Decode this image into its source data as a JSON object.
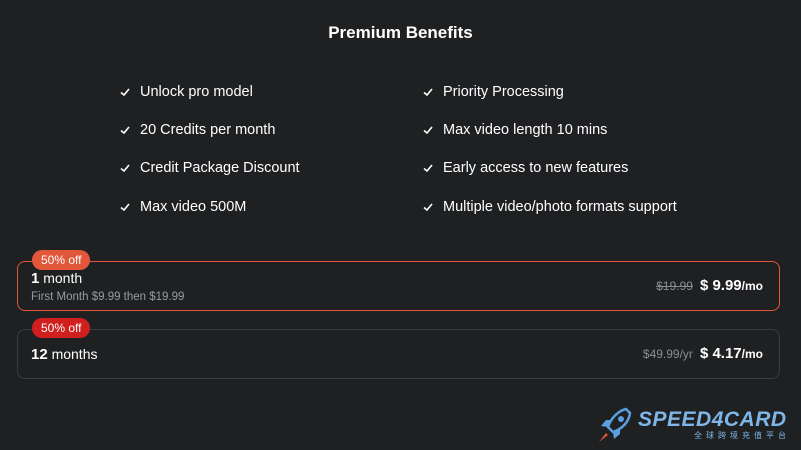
{
  "title": "Premium Benefits",
  "benefits": {
    "left": [
      "Unlock pro model",
      "20 Credits per month",
      "Credit Package Discount",
      "Max video 500M"
    ],
    "right": [
      "Priority Processing",
      "Max video length 10 mins",
      "Early access to new features",
      "Multiple video/photo formats support"
    ]
  },
  "plans": [
    {
      "badge": "50% off",
      "name_num": "1",
      "name_unit": " month",
      "subtitle": "First Month $9.99 then $19.99",
      "old_price": "$19.99",
      "new_price": "$ 9.99",
      "per": "/mo",
      "selected": true
    },
    {
      "badge": "50% off",
      "name_num": "12",
      "name_unit": " months",
      "old_price": "$49.99/yr",
      "new_price": "$ 4.17",
      "per": "/mo",
      "selected": false
    }
  ],
  "watermark": {
    "brand": "SPEED4CARD",
    "tagline": "全球跨境充值平台"
  },
  "colors": {
    "background": "#1f2022",
    "accent": "#e2573a",
    "badge_red": "#d11f1f",
    "watermark": "#7fb6e8"
  }
}
